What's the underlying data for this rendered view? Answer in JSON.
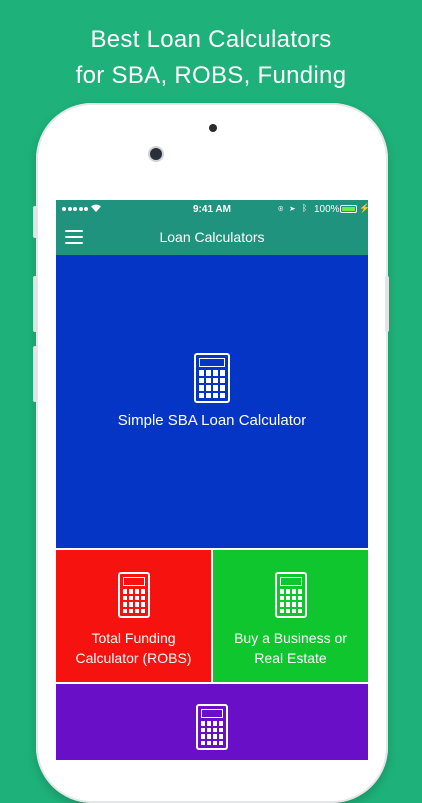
{
  "headline": {
    "line1": "Best Loan Calculators",
    "line2": "for SBA, ROBS, Funding"
  },
  "status_bar": {
    "carrier_signal": "signal-dots-icon",
    "time": "9:41 AM",
    "battery_percent": "100%"
  },
  "nav": {
    "title": "Loan Calculators",
    "menu_icon": "hamburger-menu-icon"
  },
  "tiles": [
    {
      "label": "Simple SBA Loan Calculator",
      "color": "#0535c4",
      "icon": "calculator-icon"
    },
    {
      "label_line1": "Total Funding",
      "label_line2": "Calculator (ROBS)",
      "color": "#f6120f",
      "icon": "calculator-icon"
    },
    {
      "label_line1": "Buy a Business or",
      "label_line2": "Real Estate",
      "color": "#10c62e",
      "icon": "calculator-icon"
    },
    {
      "color": "#6a0fc8",
      "icon": "calculator-icon"
    }
  ],
  "colors": {
    "background": "#1eb27a",
    "navbar": "#20937f"
  }
}
